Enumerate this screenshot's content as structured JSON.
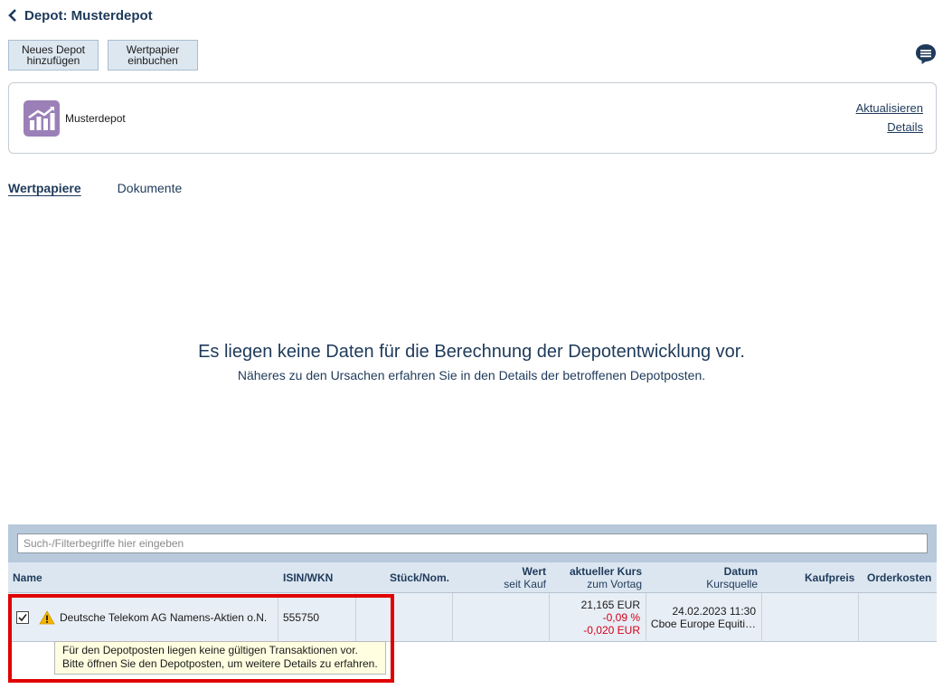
{
  "header": {
    "title": "Depot: Musterdepot"
  },
  "toolbar": {
    "new_depot_line1": "Neues Depot",
    "new_depot_line2": "hinzufügen",
    "book_security_line1": "Wertpapier",
    "book_security_line2": "einbuchen"
  },
  "card": {
    "name": "Musterdepot",
    "refresh_label": "Aktualisieren",
    "details_label": "Details"
  },
  "tabs": [
    {
      "label": "Wertpapiere",
      "active": true
    },
    {
      "label": "Dokumente",
      "active": false
    }
  ],
  "empty_state": {
    "main": "Es liegen keine Daten für die Berechnung der Depotentwicklung vor.",
    "sub": "Näheres zu den Ursachen erfahren Sie in den Details der betroffenen Depotposten."
  },
  "table": {
    "filter_placeholder": "Such-/Filterbegriffe hier eingeben",
    "columns": {
      "name": "Name",
      "isin": "ISIN/WKN",
      "units": "Stück/Nom.",
      "value": "Wert",
      "value_sub": "seit Kauf",
      "price": "aktueller Kurs",
      "price_sub": "zum Vortag",
      "date": "Datum",
      "date_sub": "Kursquelle",
      "buy_price": "Kaufpreis",
      "order_costs": "Orderkosten"
    },
    "rows": [
      {
        "name": "Deutsche Telekom AG Namens-Aktien o.N.",
        "isin": "555750",
        "price": "21,165 EUR",
        "change_pct": "-0,09 %",
        "change_abs": "-0,020 EUR",
        "date": "24.02.2023 11:30",
        "source": "Cboe Europe Equiti…",
        "checked": true
      }
    ]
  },
  "tooltip": {
    "line1": "Für den Depotposten liegen keine gültigen Transaktionen vor.",
    "line2": "Bitte öffnen Sie den Depotposten, um weitere Details zu erfahren."
  },
  "colors": {
    "accent": "#1e3a5a",
    "negative": "#d4001a",
    "highlight": "#e00000",
    "logo": "#9b80b8"
  }
}
